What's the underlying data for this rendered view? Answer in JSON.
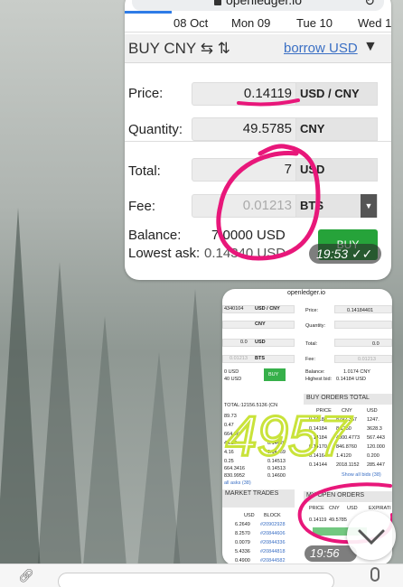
{
  "shot1": {
    "url": "openledger.io",
    "dates": [
      "08 Oct",
      "Mon 09",
      "Tue 10",
      "Wed 1"
    ],
    "title": "BUY CNY",
    "borrow": "borrow USD",
    "price_label": "Price:",
    "price_value": "0.14119",
    "price_unit": "USD / CNY",
    "qty_label": "Quantity:",
    "qty_value": "49.5785",
    "qty_unit": "CNY",
    "total_label": "Total:",
    "total_value": "7",
    "total_unit": "USD",
    "fee_label": "Fee:",
    "fee_value": "0.01213",
    "fee_unit": "BTS",
    "balance_label": "Balance:",
    "balance_value": "7.0000 USD",
    "lowest_label": "Lowest ask:",
    "lowest_value": "0.14340 USD",
    "buy_label": "BUY",
    "time": "19:53"
  },
  "shot2": {
    "url": "openledger.io",
    "left_price": "4340104",
    "left_price_unit": "USD / CNY",
    "left_cny": "CNY",
    "left_zero1": "0.0",
    "left_usd": "USD",
    "left_zero2": "0.0",
    "left_fee": "0.01213",
    "left_bts": "BTS",
    "left_bal": "0 USD",
    "left_ask": "40 USD",
    "left_buy": "BUY",
    "price_label": "Price:",
    "price_value": "0.14184401",
    "qty_label": "Quantity:",
    "total_label": "Total:",
    "total_value": "0.0",
    "fee_label": "Fee:",
    "fee_value": "0.01213",
    "balance_label": "Balance:",
    "balance_value": "1.0174 CNY",
    "bid_label": "Highest bid:",
    "bid_value": "0.14184 USD",
    "buy_orders": "BUY ORDERS",
    "total_hdr": "TOTAL",
    "hdr_price": "PRICE",
    "hdr_cny": "CNY",
    "hdr_usd": "USD",
    "hdr_block": "BLOCK",
    "hdr_expir": "EXPIRATI",
    "order_prices": [
      "0.14184",
      "0.14184",
      "0.14184",
      "0.14170",
      "0.14164",
      "0.14144"
    ],
    "order_cny": [
      "8792.357",
      "8.1750",
      "4000.4773",
      "846.8760",
      "1.4120",
      "2018.1152"
    ],
    "order_usd": [
      "1247.",
      "3628.3",
      "567.443",
      "120.000",
      "0.200",
      "285.447"
    ],
    "show_bids": "Show all bids (38)",
    "ask_total": "TOTAL:12156.5136 (CN",
    "ask_prices": [
      "89.73",
      "0.47",
      "664.86",
      "44.17",
      "4.16",
      "0.25",
      "664.3416",
      "830.9952"
    ],
    "ask_vals": [
      "0.14426",
      "0.14469",
      "0.14513",
      "0.14513",
      "0.14513",
      "0.14600"
    ],
    "all_asks": "all asks (38)",
    "market_trades": "MARKET TRADES",
    "trade_usd": [
      "6.2649",
      "8.2570",
      "0.0079",
      "5.4336",
      "0.4900"
    ],
    "trade_block": [
      "#20902928",
      "#20844606",
      "#20844336",
      "#20844818",
      "#20844582"
    ],
    "my_orders": "MY OPEN ORDERS",
    "my_order_price": "0.14119",
    "my_order_cny": "49.5785",
    "time": "19:56"
  },
  "handwriting": "4957",
  "colors": {
    "accent": "#2e7be6",
    "buy": "#26a33a",
    "marker_pink": "#e8177a",
    "marker_green": "#c9e33a"
  }
}
